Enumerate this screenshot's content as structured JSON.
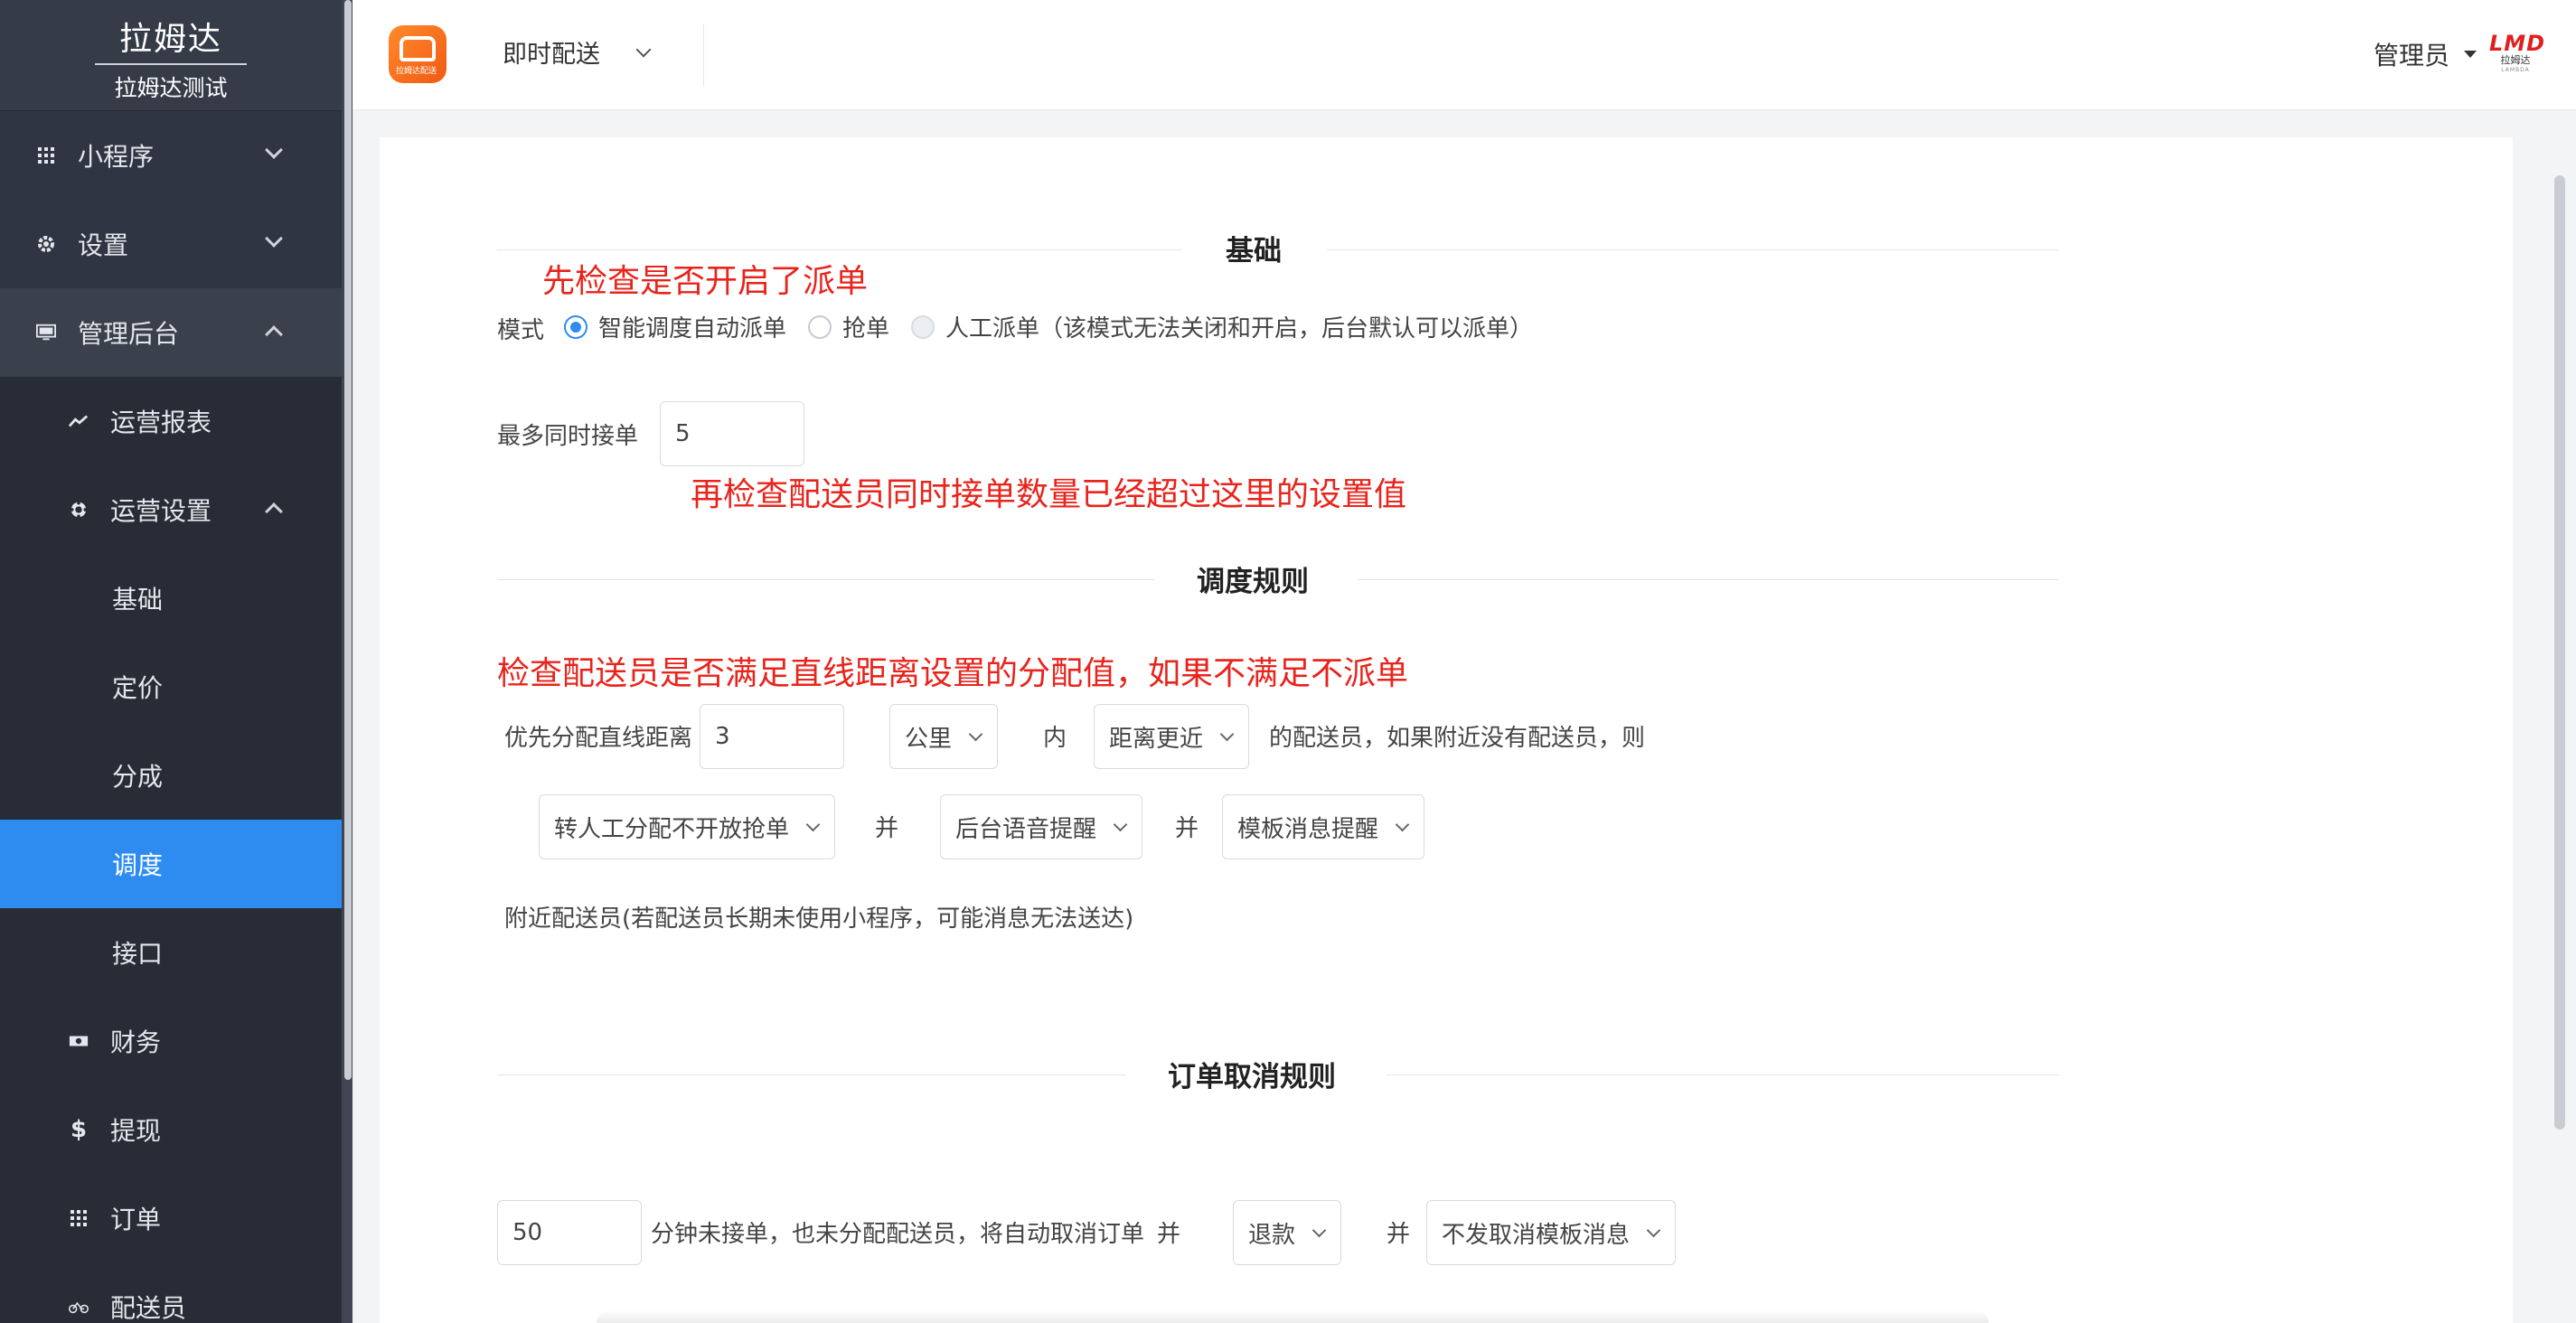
{
  "brand": {
    "title": "拉姆达",
    "subtitle": "拉姆达测试"
  },
  "sidebar": {
    "items": [
      {
        "label": "小程序",
        "icon": "grid-icon"
      },
      {
        "label": "设置",
        "icon": "gear-icon"
      },
      {
        "label": "管理后台",
        "icon": "monitor-icon"
      },
      {
        "label": "运营报表",
        "icon": "trend-icon"
      },
      {
        "label": "运营设置",
        "icon": "cog-icon"
      },
      {
        "label": "基础"
      },
      {
        "label": "定价"
      },
      {
        "label": "分成"
      },
      {
        "label": "调度"
      },
      {
        "label": "接口"
      },
      {
        "label": "财务",
        "icon": "money-icon"
      },
      {
        "label": "提现",
        "icon": "dollar-icon"
      },
      {
        "label": "订单",
        "icon": "grid-icon"
      },
      {
        "label": "配送员",
        "icon": "bicycle-icon"
      }
    ],
    "active_color": "#2e8cf0"
  },
  "header": {
    "app_logo_caption": "拉姆达配送",
    "mode": "即时配送",
    "user": "管理员",
    "brand_mark": "LMD",
    "brand_mark_sub": "拉姆达",
    "brand_mark_en": "LAMBDA"
  },
  "sections": {
    "basic": "基础",
    "dispatch": "调度规则",
    "cancel": "订单取消规则"
  },
  "notes": {
    "n1": "先检查是否开启了派单",
    "n2": "再检查配送员同时接单数量已经超过这里的设置值",
    "n3": "检查配送员是否满足直线距离设置的分配值，如果不满足不派单"
  },
  "form": {
    "mode_label": "模式",
    "modes": [
      {
        "label": "智能调度自动派单",
        "checked": true
      },
      {
        "label": "抢单",
        "checked": false
      },
      {
        "label": "人工派单（该模式无法关闭和开启，后台默认可以派单）",
        "checked": false,
        "disabled": true
      }
    ],
    "max_label": "最多同时接单",
    "max_value": "5",
    "distance_label": "优先分配直线距离",
    "distance_value": "3",
    "unit": "公里",
    "within": "内",
    "sort": "距离更近",
    "tail": "的配送员，如果附近没有配送员，则",
    "fallback": "转人工分配不开放抢单",
    "and": "并",
    "notify1": "后台语音提醒",
    "notify2": "模板消息提醒",
    "nearby_note": "附近配送员(若配送员长期未使用小程序，可能消息无法送达)",
    "cancel_minutes": "50",
    "cancel_text": "分钟未接单，也未分配配送员，将自动取消订单",
    "cancel_and": "并",
    "cancel_action": "退款",
    "cancel_and2": "并",
    "cancel_msg": "不发取消模板消息"
  },
  "colors": {
    "accent": "#2e8cf0",
    "note_red": "#e8241c",
    "sidebar_bg": "#2f3542"
  }
}
